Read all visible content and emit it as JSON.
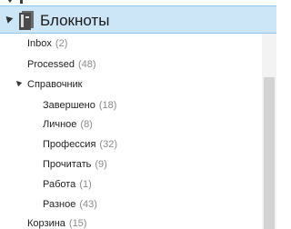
{
  "header": {
    "title": "Блокноты",
    "icon": "notebook-icon"
  },
  "items": [
    {
      "label": "Inbox",
      "count": "(2)"
    },
    {
      "label": "Processed",
      "count": "(48)"
    },
    {
      "label": "Справочник",
      "count": ""
    },
    {
      "label": "Завершено",
      "count": "(18)"
    },
    {
      "label": "Личное",
      "count": "(8)"
    },
    {
      "label": "Профессия",
      "count": "(32)"
    },
    {
      "label": "Прочитать",
      "count": "(9)"
    },
    {
      "label": "Работа",
      "count": "(1)"
    },
    {
      "label": "Разное",
      "count": "(43)"
    },
    {
      "label": "Корзина",
      "count": "(15)"
    }
  ],
  "colors": {
    "selection_bg": "#cde6f7",
    "selection_border": "#90c5ea",
    "count_text": "#8a8a8a"
  }
}
